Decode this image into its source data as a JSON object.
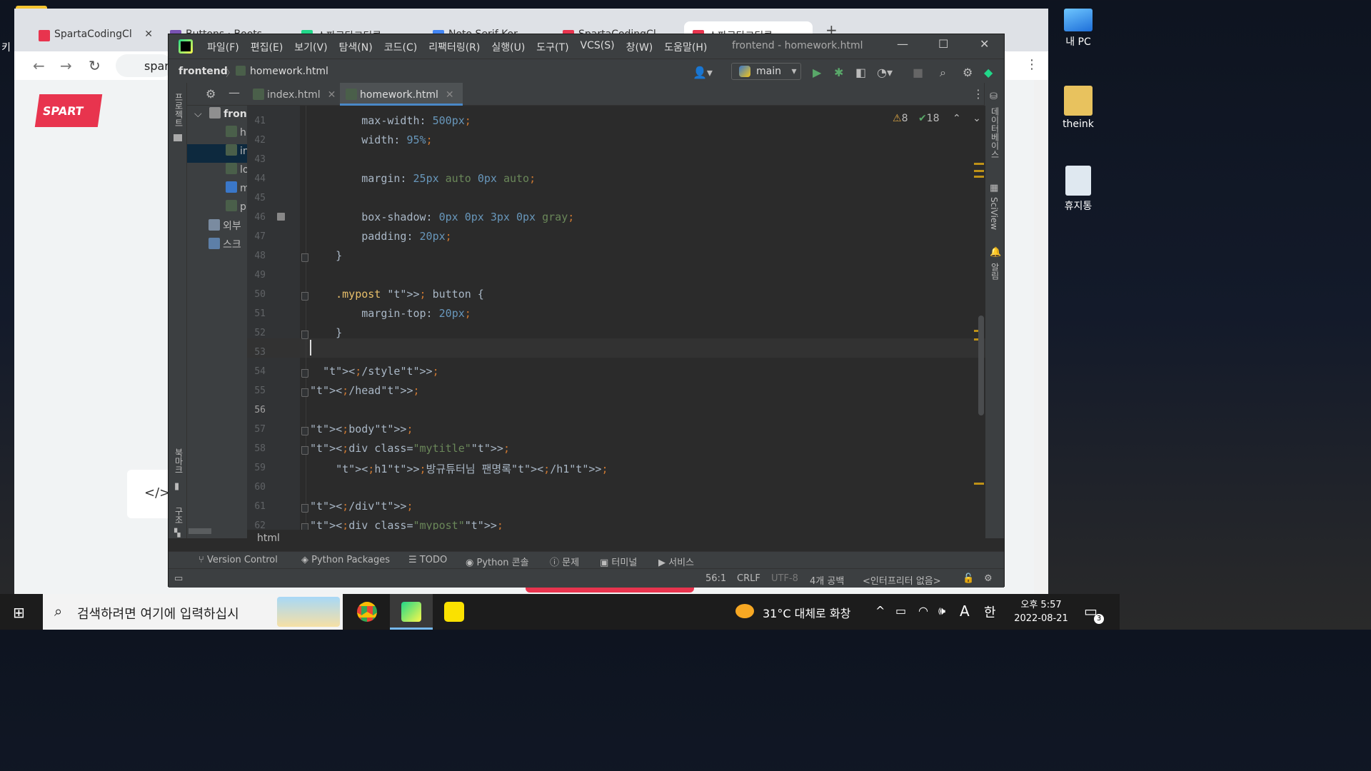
{
  "desktop": {
    "icons": [
      {
        "label": "내 PC",
        "icon": "monitor-icon"
      },
      {
        "label": "theink",
        "icon": "user-folder-icon"
      },
      {
        "label": "휴지통",
        "icon": "recycle-bin-icon"
      }
    ],
    "left_edge_char": "키"
  },
  "chrome": {
    "tabs": [
      {
        "label": "SpartaCodingCl",
        "color": "#e8344e"
      },
      {
        "label": "Buttons · Boots",
        "color": "#7952b3"
      },
      {
        "label": "스파르타코딩클",
        "color": "#1e1e1e"
      },
      {
        "label": "Noto Serif Kor",
        "color": "#4285f4"
      },
      {
        "label": "SpartaCodingCl",
        "color": "#e8344e"
      },
      {
        "label": "스파르타코딩클",
        "color": "#e8344e"
      }
    ],
    "new_tab": "+",
    "address": "spar",
    "page_logo": "SPART",
    "code_icon": "</>"
  },
  "ide": {
    "menus": [
      "파일(F)",
      "편집(E)",
      "보기(V)",
      "탐색(N)",
      "코드(C)",
      "리팩터링(R)",
      "실행(U)",
      "도구(T)",
      "VCS(S)",
      "창(W)",
      "도움말(H)"
    ],
    "window_title": "frontend - homework.html",
    "breadcrumb": {
      "project": "frontend",
      "file": "homework.html"
    },
    "run_config": "main",
    "left_strip": {
      "project": "프로젝트",
      "bookmarks": "북마크",
      "structure": "구조"
    },
    "right_strip": {
      "database": "데이터베이스",
      "sciview": "SciView",
      "notifications": "알림"
    },
    "project_tree": {
      "root": "fron",
      "files": [
        "h",
        "in",
        "lo",
        "m",
        "p"
      ],
      "external": "외부",
      "scratches": "스크"
    },
    "tabs": [
      {
        "label": "index.html",
        "active": false
      },
      {
        "label": "homework.html",
        "active": true
      }
    ],
    "inspections": {
      "warnings": "8",
      "ok": "18"
    },
    "code_lines": [
      {
        "n": "41",
        "text": "        max-width: 500px;"
      },
      {
        "n": "42",
        "text": "        width: 95%;"
      },
      {
        "n": "43",
        "text": ""
      },
      {
        "n": "44",
        "text": "        margin: 25px auto 0px auto;"
      },
      {
        "n": "45",
        "text": ""
      },
      {
        "n": "46",
        "text": "        box-shadow: 0px 0px 3px 0px gray;"
      },
      {
        "n": "47",
        "text": "        padding: 20px;"
      },
      {
        "n": "48",
        "text": "    }"
      },
      {
        "n": "49",
        "text": ""
      },
      {
        "n": "50",
        "text": "    .mypost > button {"
      },
      {
        "n": "51",
        "text": "        margin-top: 20px;"
      },
      {
        "n": "52",
        "text": "    }"
      },
      {
        "n": "53",
        "text": ""
      },
      {
        "n": "54",
        "text": "  </style>"
      },
      {
        "n": "55",
        "text": "</head>"
      },
      {
        "n": "56",
        "text": ""
      },
      {
        "n": "57",
        "text": "<body>"
      },
      {
        "n": "58",
        "text": "<div class=\"mytitle\">"
      },
      {
        "n": "59",
        "text": "    <h1>방규튜터님 팬명록</h1>"
      },
      {
        "n": "60",
        "text": ""
      },
      {
        "n": "61",
        "text": "</div>"
      },
      {
        "n": "62",
        "text": "<div class=\"mypost\">"
      }
    ],
    "path_bar": "html",
    "tool_windows": [
      "Version Control",
      "Python Packages",
      "TODO",
      "Python 콘솔",
      "문제",
      "터미널",
      "서비스"
    ],
    "status": {
      "position": "56:1",
      "line_sep": "CRLF",
      "encoding": "UTF-8",
      "indent": "4개 공백",
      "interpreter": "<인터프리터 없음>"
    }
  },
  "taskbar": {
    "search_placeholder": "검색하려면 여기에 입력하십시",
    "weather": "31°C  대체로 화창",
    "ime": "A",
    "ime2": "한",
    "time": "오후 5:57",
    "date": "2022-08-21",
    "notifications": "3"
  }
}
